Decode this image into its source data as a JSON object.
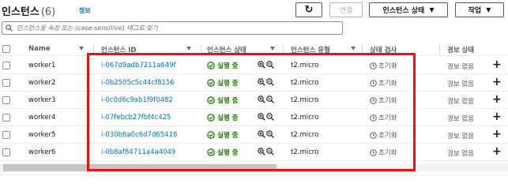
{
  "header": {
    "title": "인스턴스",
    "count": "(6)",
    "info_link": "정보",
    "refresh_label": "↻",
    "connect_label": "연결",
    "instance_state_label": "인스턴스 상태",
    "actions_label": "작업"
  },
  "search": {
    "placeholder": "인스턴스을 속성 또는 (case-sensitive) 태그로 찾기"
  },
  "table": {
    "columns": [
      "Name",
      "인스턴스 ID",
      "인스턴스 상태",
      "인스턴스 유형",
      "상태 검사",
      "경보 상태"
    ],
    "rows": [
      {
        "name": "worker1",
        "id": "i-067d9adb7211a649f",
        "state": "실행 중",
        "type": "t2.micro",
        "check": "초기화",
        "alarm": "경보 없음"
      },
      {
        "name": "worker2",
        "id": "i-0b2505c5c44cf8156",
        "state": "실행 중",
        "type": "t2.micro",
        "check": "초기화",
        "alarm": "경보 없음"
      },
      {
        "name": "worker3",
        "id": "i-0c0d6c9ab1f9f0482",
        "state": "실행 중",
        "type": "t2.micro",
        "check": "초기화",
        "alarm": "경보 없음"
      },
      {
        "name": "worker4",
        "id": "i-07febcb27fbf4c425",
        "state": "실행 중",
        "type": "t2.micro",
        "check": "초기화",
        "alarm": "경보 없음"
      },
      {
        "name": "worker5",
        "id": "i-030b6a0c6d7d65418",
        "state": "실행 중",
        "type": "t2.micro",
        "check": "초기화",
        "alarm": "경보 없음"
      },
      {
        "name": "worker6",
        "id": "i-0b8af84711a4a4049",
        "state": "실행 중",
        "type": "t2.micro",
        "check": "초기화",
        "alarm": "경보 없음"
      }
    ]
  },
  "colors": {
    "link": "#0073bb",
    "running": "#1d8102",
    "highlight": "#ee1111"
  }
}
